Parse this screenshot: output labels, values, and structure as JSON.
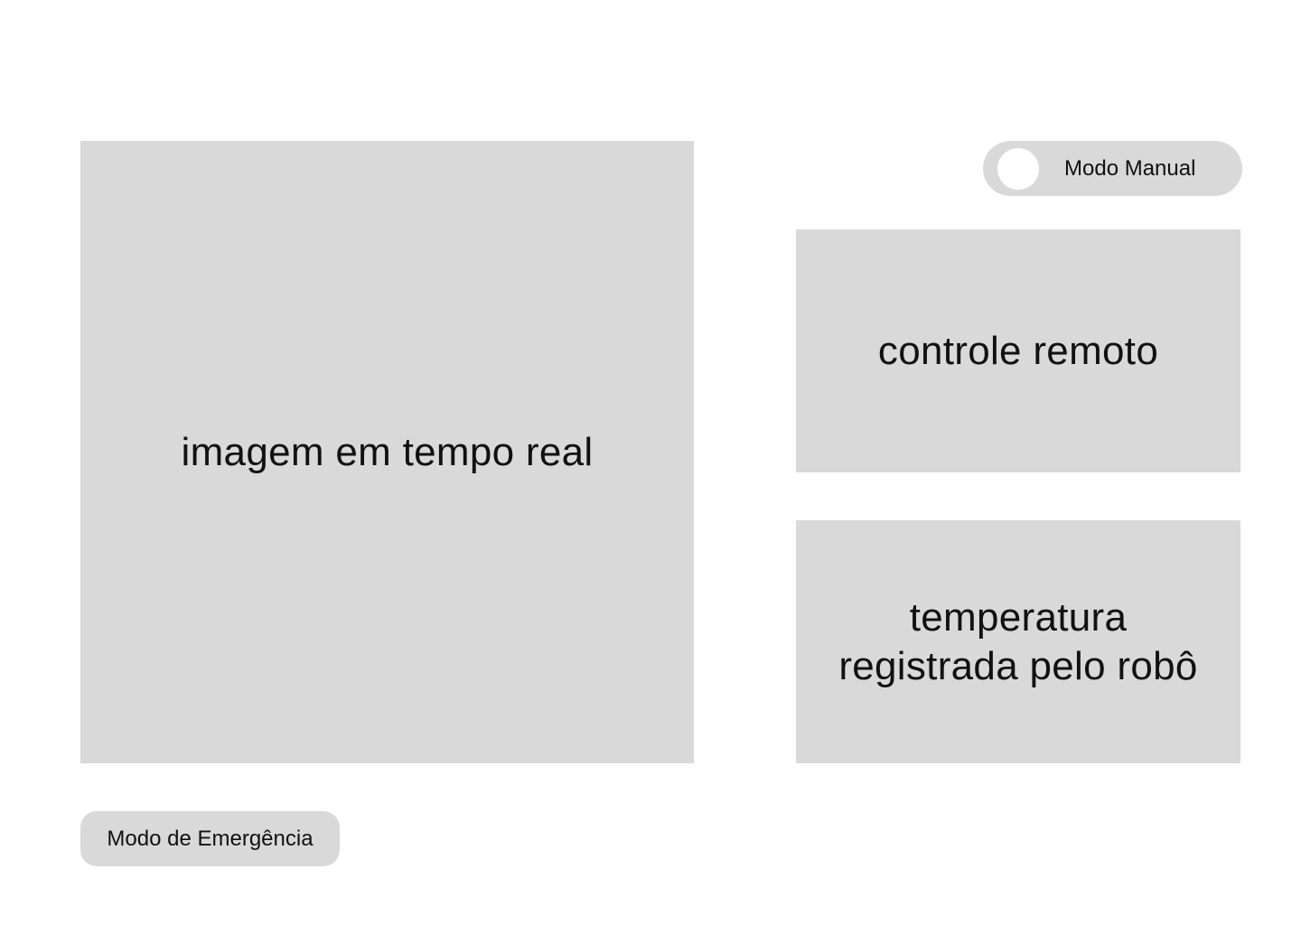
{
  "panels": {
    "live_image": {
      "label": "imagem em tempo real"
    },
    "remote_control": {
      "label": "controle remoto"
    },
    "temperature": {
      "label": "temperatura\nregistrada pelo robô"
    }
  },
  "manual_mode_toggle": {
    "label": "Modo Manual",
    "state": "off"
  },
  "emergency_button": {
    "label": "Modo de Emergência"
  },
  "colors": {
    "background": "#ffffff",
    "panel": "#d9d9d9",
    "toggle_knob": "#ffffff",
    "text": "#111111"
  },
  "icons": {
    "toggle_knob": "toggle-knob-icon"
  }
}
